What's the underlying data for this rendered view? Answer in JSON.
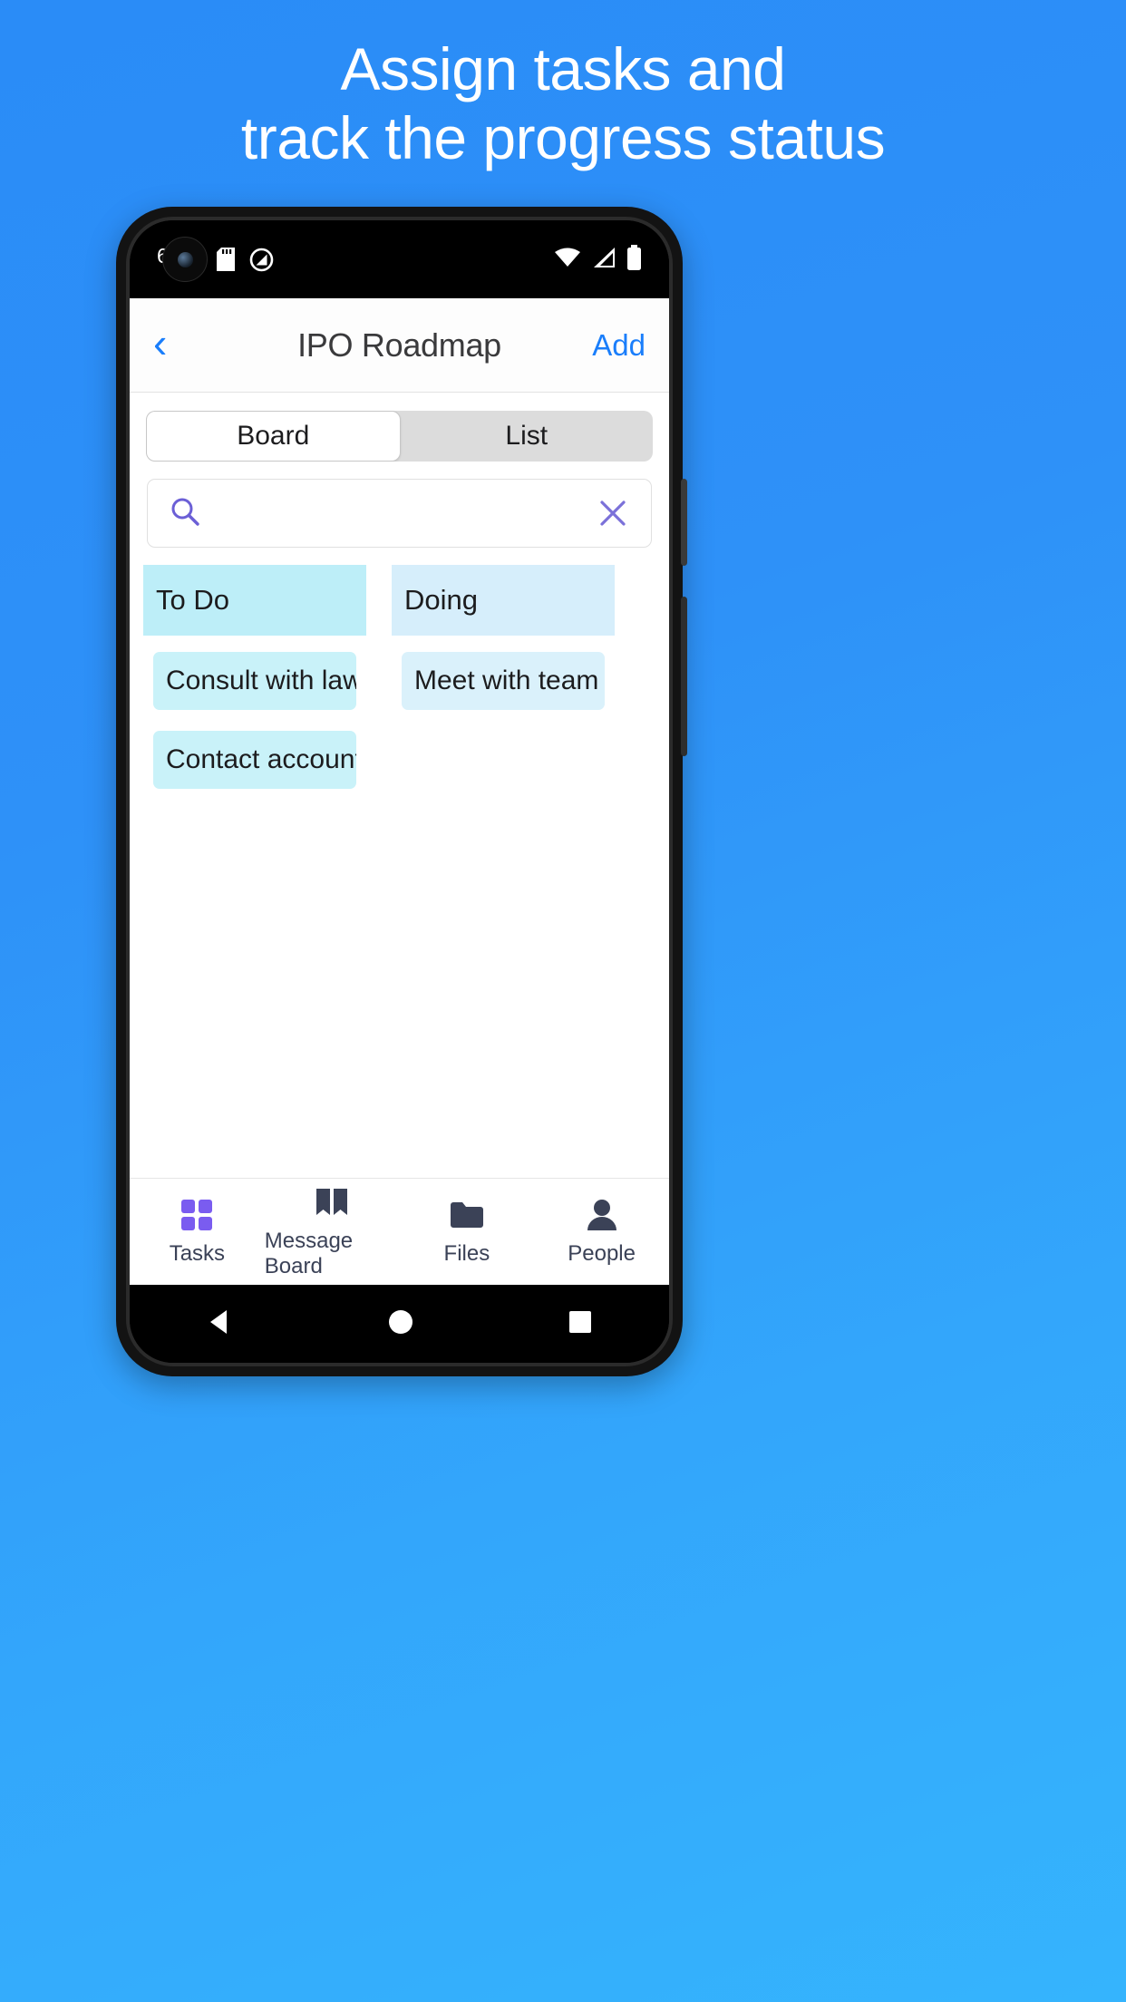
{
  "promo": {
    "line1": "Assign tasks and",
    "line2": "track the progress status",
    "background_color": "#2f93f8"
  },
  "status_bar": {
    "left_icons": [
      "camera-punchhole",
      "sd-card-icon",
      "do-not-disturb-icon"
    ],
    "right_icons": [
      "wifi-icon",
      "cellular-signal-icon",
      "battery-icon"
    ]
  },
  "navbar": {
    "back_label": "‹",
    "title": "IPO Roadmap",
    "action_label": "Add",
    "accent_color": "#1a7efb"
  },
  "segmented_control": {
    "options": [
      {
        "label": "Board",
        "selected": true
      },
      {
        "label": "List",
        "selected": false
      }
    ]
  },
  "search": {
    "value": "",
    "placeholder": "",
    "icon": "search-icon",
    "icon_color": "#6b5fd6",
    "clear_icon": "close-icon",
    "clear_icon_color": "#7b71d9"
  },
  "board": {
    "columns": [
      {
        "title": "To Do",
        "header_color": "#bdeef8",
        "cards": [
          {
            "title": "Consult with lawyer",
            "color": "#c9f2f9"
          },
          {
            "title": "Contact accounting firm",
            "color": "#c9f2f9"
          }
        ]
      },
      {
        "title": "Doing",
        "header_color": "#d6eefb",
        "cards": [
          {
            "title": "Meet with team",
            "color": "#daf1fb"
          }
        ]
      }
    ]
  },
  "tabbar": {
    "tabs": [
      {
        "label": "Tasks",
        "icon": "grid-icon",
        "active": true
      },
      {
        "label": "Message Board",
        "icon": "book-icon",
        "active": false
      },
      {
        "label": "Files",
        "icon": "folder-icon",
        "active": false
      },
      {
        "label": "People",
        "icon": "person-icon",
        "active": false
      }
    ],
    "active_color": "#7a5cf0",
    "inactive_color": "#3b4257"
  },
  "android_nav": {
    "buttons": [
      "back-triangle-icon",
      "home-circle-icon",
      "recents-square-icon"
    ]
  }
}
